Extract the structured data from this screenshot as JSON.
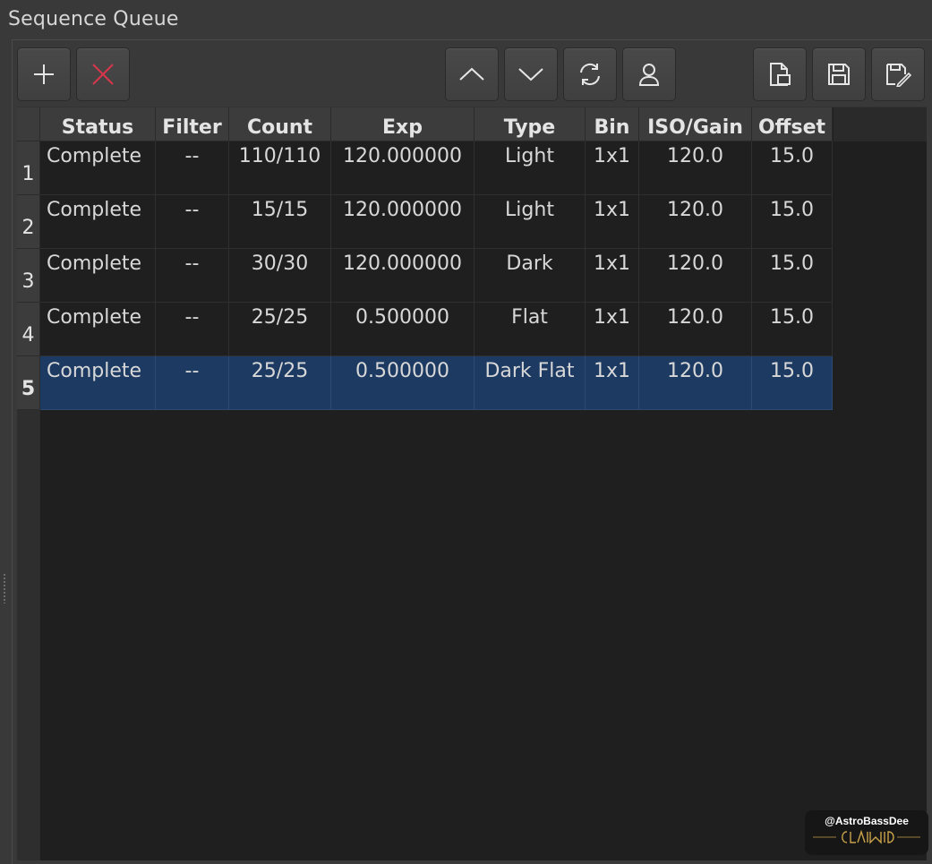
{
  "panel": {
    "title": "Sequence Queue"
  },
  "toolbar": {
    "buttons": [
      {
        "icon": "plus-icon",
        "action": "add"
      },
      {
        "icon": "close-icon",
        "action": "remove",
        "color": "#d9354c"
      },
      {
        "icon": "chevron-up-icon",
        "action": "move-up"
      },
      {
        "icon": "chevron-down-icon",
        "action": "move-down"
      },
      {
        "icon": "refresh-icon",
        "action": "reset"
      },
      {
        "icon": "user-icon",
        "action": "observer"
      },
      {
        "icon": "load-file-icon",
        "action": "load"
      },
      {
        "icon": "save-icon",
        "action": "save"
      },
      {
        "icon": "save-as-icon",
        "action": "save-as"
      }
    ]
  },
  "table": {
    "columns": [
      "Status",
      "Filter",
      "Count",
      "Exp",
      "Type",
      "Bin",
      "ISO/Gain",
      "Offset"
    ],
    "row_numbers": [
      "1",
      "2",
      "3",
      "4",
      "5"
    ],
    "selected_row": 5,
    "rows": [
      {
        "status": "Complete",
        "filter": "--",
        "count": "110/110",
        "exp": "120.000000",
        "type": "Light",
        "bin": "1x1",
        "iso": "120.0",
        "offset": "15.0"
      },
      {
        "status": "Complete",
        "filter": "--",
        "count": "15/15",
        "exp": "120.000000",
        "type": "Light",
        "bin": "1x1",
        "iso": "120.0",
        "offset": "15.0"
      },
      {
        "status": "Complete",
        "filter": "--",
        "count": "30/30",
        "exp": "120.000000",
        "type": "Dark",
        "bin": "1x1",
        "iso": "120.0",
        "offset": "15.0"
      },
      {
        "status": "Complete",
        "filter": "--",
        "count": "25/25",
        "exp": "0.500000",
        "type": "Flat",
        "bin": "1x1",
        "iso": "120.0",
        "offset": "15.0"
      },
      {
        "status": "Complete",
        "filter": "--",
        "count": "25/25",
        "exp": "0.500000",
        "type": "Dark Flat",
        "bin": "1x1",
        "iso": "120.0",
        "offset": "15.0"
      }
    ]
  },
  "watermark": {
    "handle": "@AstroBassDee"
  },
  "colors": {
    "selection": "#1c3a62",
    "delete_icon": "#d9354c",
    "watermark_logo": "#c9a24a"
  }
}
